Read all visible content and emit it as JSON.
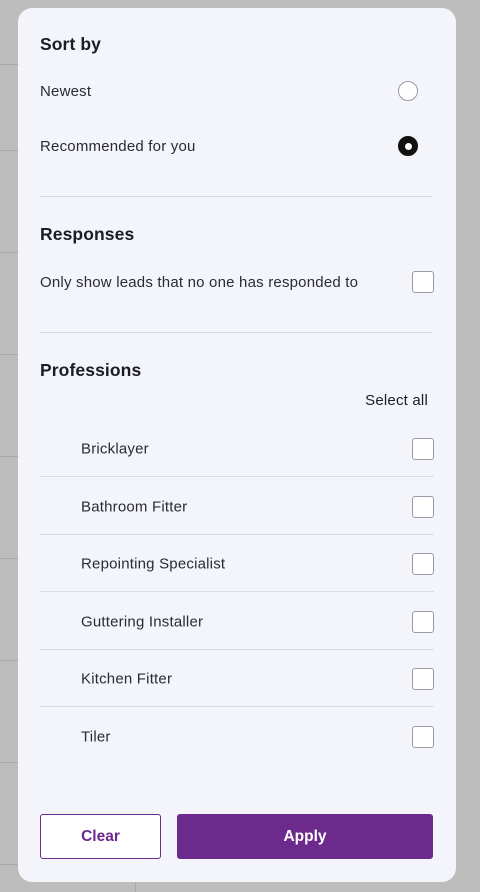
{
  "sort": {
    "title": "Sort by",
    "options": [
      {
        "label": "Newest",
        "selected": false
      },
      {
        "label": "Recommended for you",
        "selected": true
      }
    ]
  },
  "responses": {
    "title": "Responses",
    "option_label": "Only show leads that no one has responded to",
    "checked": false
  },
  "professions": {
    "title": "Professions",
    "select_all_label": "Select all",
    "items": [
      {
        "label": "Bricklayer",
        "checked": false
      },
      {
        "label": "Bathroom Fitter",
        "checked": false
      },
      {
        "label": "Repointing Specialist",
        "checked": false
      },
      {
        "label": "Guttering Installer",
        "checked": false
      },
      {
        "label": "Kitchen Fitter",
        "checked": false
      },
      {
        "label": "Tiler",
        "checked": false
      }
    ]
  },
  "actions": {
    "clear_label": "Clear",
    "apply_label": "Apply"
  },
  "colors": {
    "accent": "#6b2a8c",
    "panel_background": "#f4f5fa",
    "overlay": "#bdbdbd"
  },
  "icons": {
    "radio_selected": "radio-selected-icon",
    "radio_unselected": "radio-unselected-icon",
    "checkbox_unchecked": "checkbox-unchecked-icon"
  }
}
